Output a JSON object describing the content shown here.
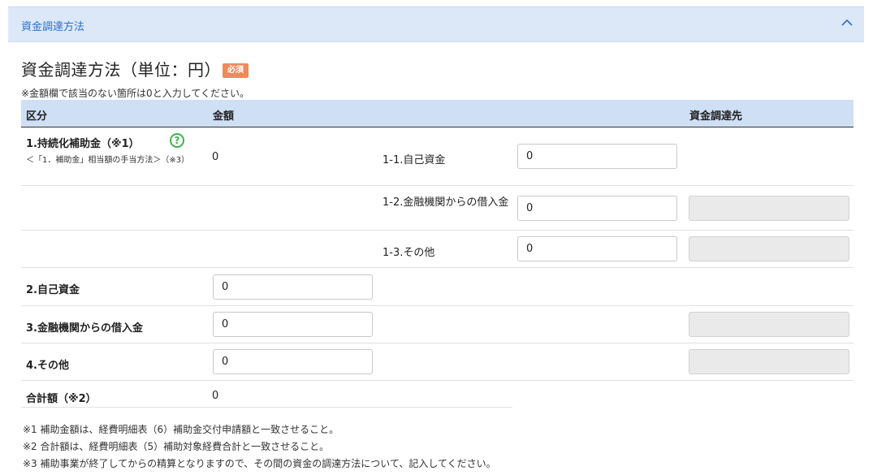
{
  "panel": {
    "title": "資金調達方法"
  },
  "section": {
    "title": "資金調達方法（単位：円）",
    "required_badge": "必須",
    "note": "※金額欄で該当のない箇所は0と入力してください。"
  },
  "table": {
    "headers": {
      "category": "区分",
      "amount": "金額",
      "source": "資金調達先"
    },
    "row1": {
      "label": "1.持続化補助金（※1）",
      "sublabel": "＜「1．補助金」相当額の手当方法＞（※3）",
      "amount": "0",
      "subrows": [
        {
          "label": "1-1.自己資金",
          "value": "0"
        },
        {
          "label": "1-2.金融機関からの借入金",
          "value": "0"
        },
        {
          "label": "1-3.その他",
          "value": "0"
        }
      ]
    },
    "row2": {
      "label": "2.自己資金",
      "value": "0"
    },
    "row3": {
      "label": "3.金融機関からの借入金",
      "value": "0"
    },
    "row4": {
      "label": "4.その他",
      "value": "0"
    },
    "total": {
      "label": "合計額（※2）",
      "value": "0"
    }
  },
  "footnotes": [
    "※1 補助金額は、経費明細表（6）補助金交付申請額と一致させること。",
    "※2 合計額は、経費明細表（5）補助対象経費合計と一致させること。",
    "※3 補助事業が終了してからの精算となりますので、その間の資金の調達方法について、記入してください。"
  ],
  "icons": {
    "collapse": "chevron-up-icon",
    "help": "question-circle-icon"
  },
  "colors": {
    "header_bg": "#dce8f8",
    "header_text": "#2a6fcc",
    "badge": "#f08a5a",
    "help": "#3cb44b"
  }
}
